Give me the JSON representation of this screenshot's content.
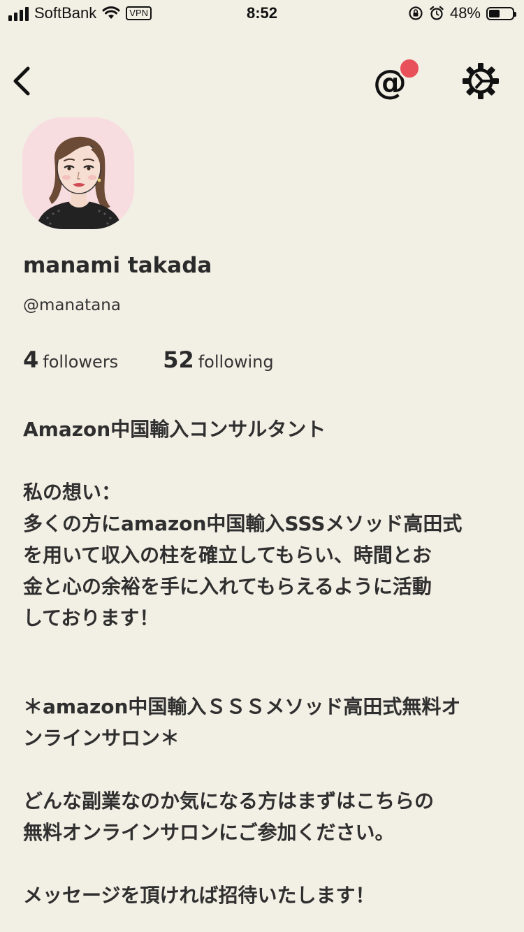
{
  "status_bar": {
    "carrier": "SoftBank",
    "vpn": "VPN",
    "time": "8:52",
    "battery_percent": "48%",
    "battery_level": 0.48
  },
  "nav": {
    "mention_icon": "at-sign-icon",
    "settings_icon": "gear-icon",
    "back_icon": "chevron-left-icon",
    "notification_color": "#e8505a"
  },
  "profile": {
    "name": "manami takada",
    "username": "@manatana",
    "followers_count": "4",
    "followers_label": "followers",
    "following_count": "52",
    "following_label": "following"
  },
  "bio": {
    "line1": "Amazon中国輸入コンサルタント",
    "heading": "私の想い：",
    "paragraph1_line1": "多くの方にamazon中国輸入SSSメソッド高田式",
    "paragraph1_line2": "を用いて収入の柱を確立してもらい、時間とお",
    "paragraph1_line3": "金と心の余裕を手に入れてもらえるように活動",
    "paragraph1_line4": "しております！",
    "salon_line1": "＊amazon中国輸入ＳＳＳメソッド高田式無料オ",
    "salon_line2": "ンラインサロン＊",
    "paragraph2_line1": "どんな副業なのか気になる方はまずはこちらの",
    "paragraph2_line2": "無料オンラインサロンにご参加ください。",
    "closing": "メッセージを頂ければ招待いたします！"
  },
  "colors": {
    "background": "#f2efe4",
    "avatar_background": "#f8dde0"
  }
}
